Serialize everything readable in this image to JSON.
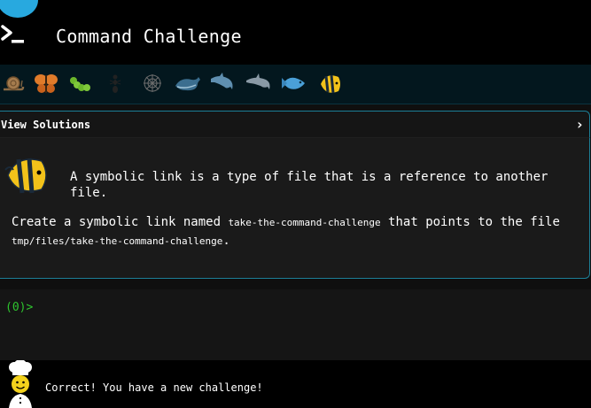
{
  "header": {
    "title": "Command Challenge",
    "logo_icon": "terminal-prompt-icon"
  },
  "levels": {
    "icons": [
      "snail-icon",
      "butterfly-icon",
      "caterpillar-icon",
      "ant-icon",
      "spider-web-icon",
      "whale-icon",
      "dolphin-icon",
      "dolphin-icon",
      "fish-icon",
      "angelfish-icon"
    ]
  },
  "solutions": {
    "label": "View Solutions",
    "chevron": "›"
  },
  "challenge": {
    "description": "A symbolic link is a type of file that is a reference to another file.",
    "task_prefix": "Create a symbolic link named ",
    "link_name": "take-the-command-challenge",
    "task_middle": " that points to the file ",
    "target_path": "tmp/files/take-the-command-challenge",
    "task_suffix": "."
  },
  "terminal": {
    "prompt": "(0)>"
  },
  "footer": {
    "message": "Correct! You have a new challenge!"
  },
  "colors": {
    "accent": "#1c7f97",
    "prompt_green": "#2ec42e",
    "dome_blue": "#28a9df"
  }
}
